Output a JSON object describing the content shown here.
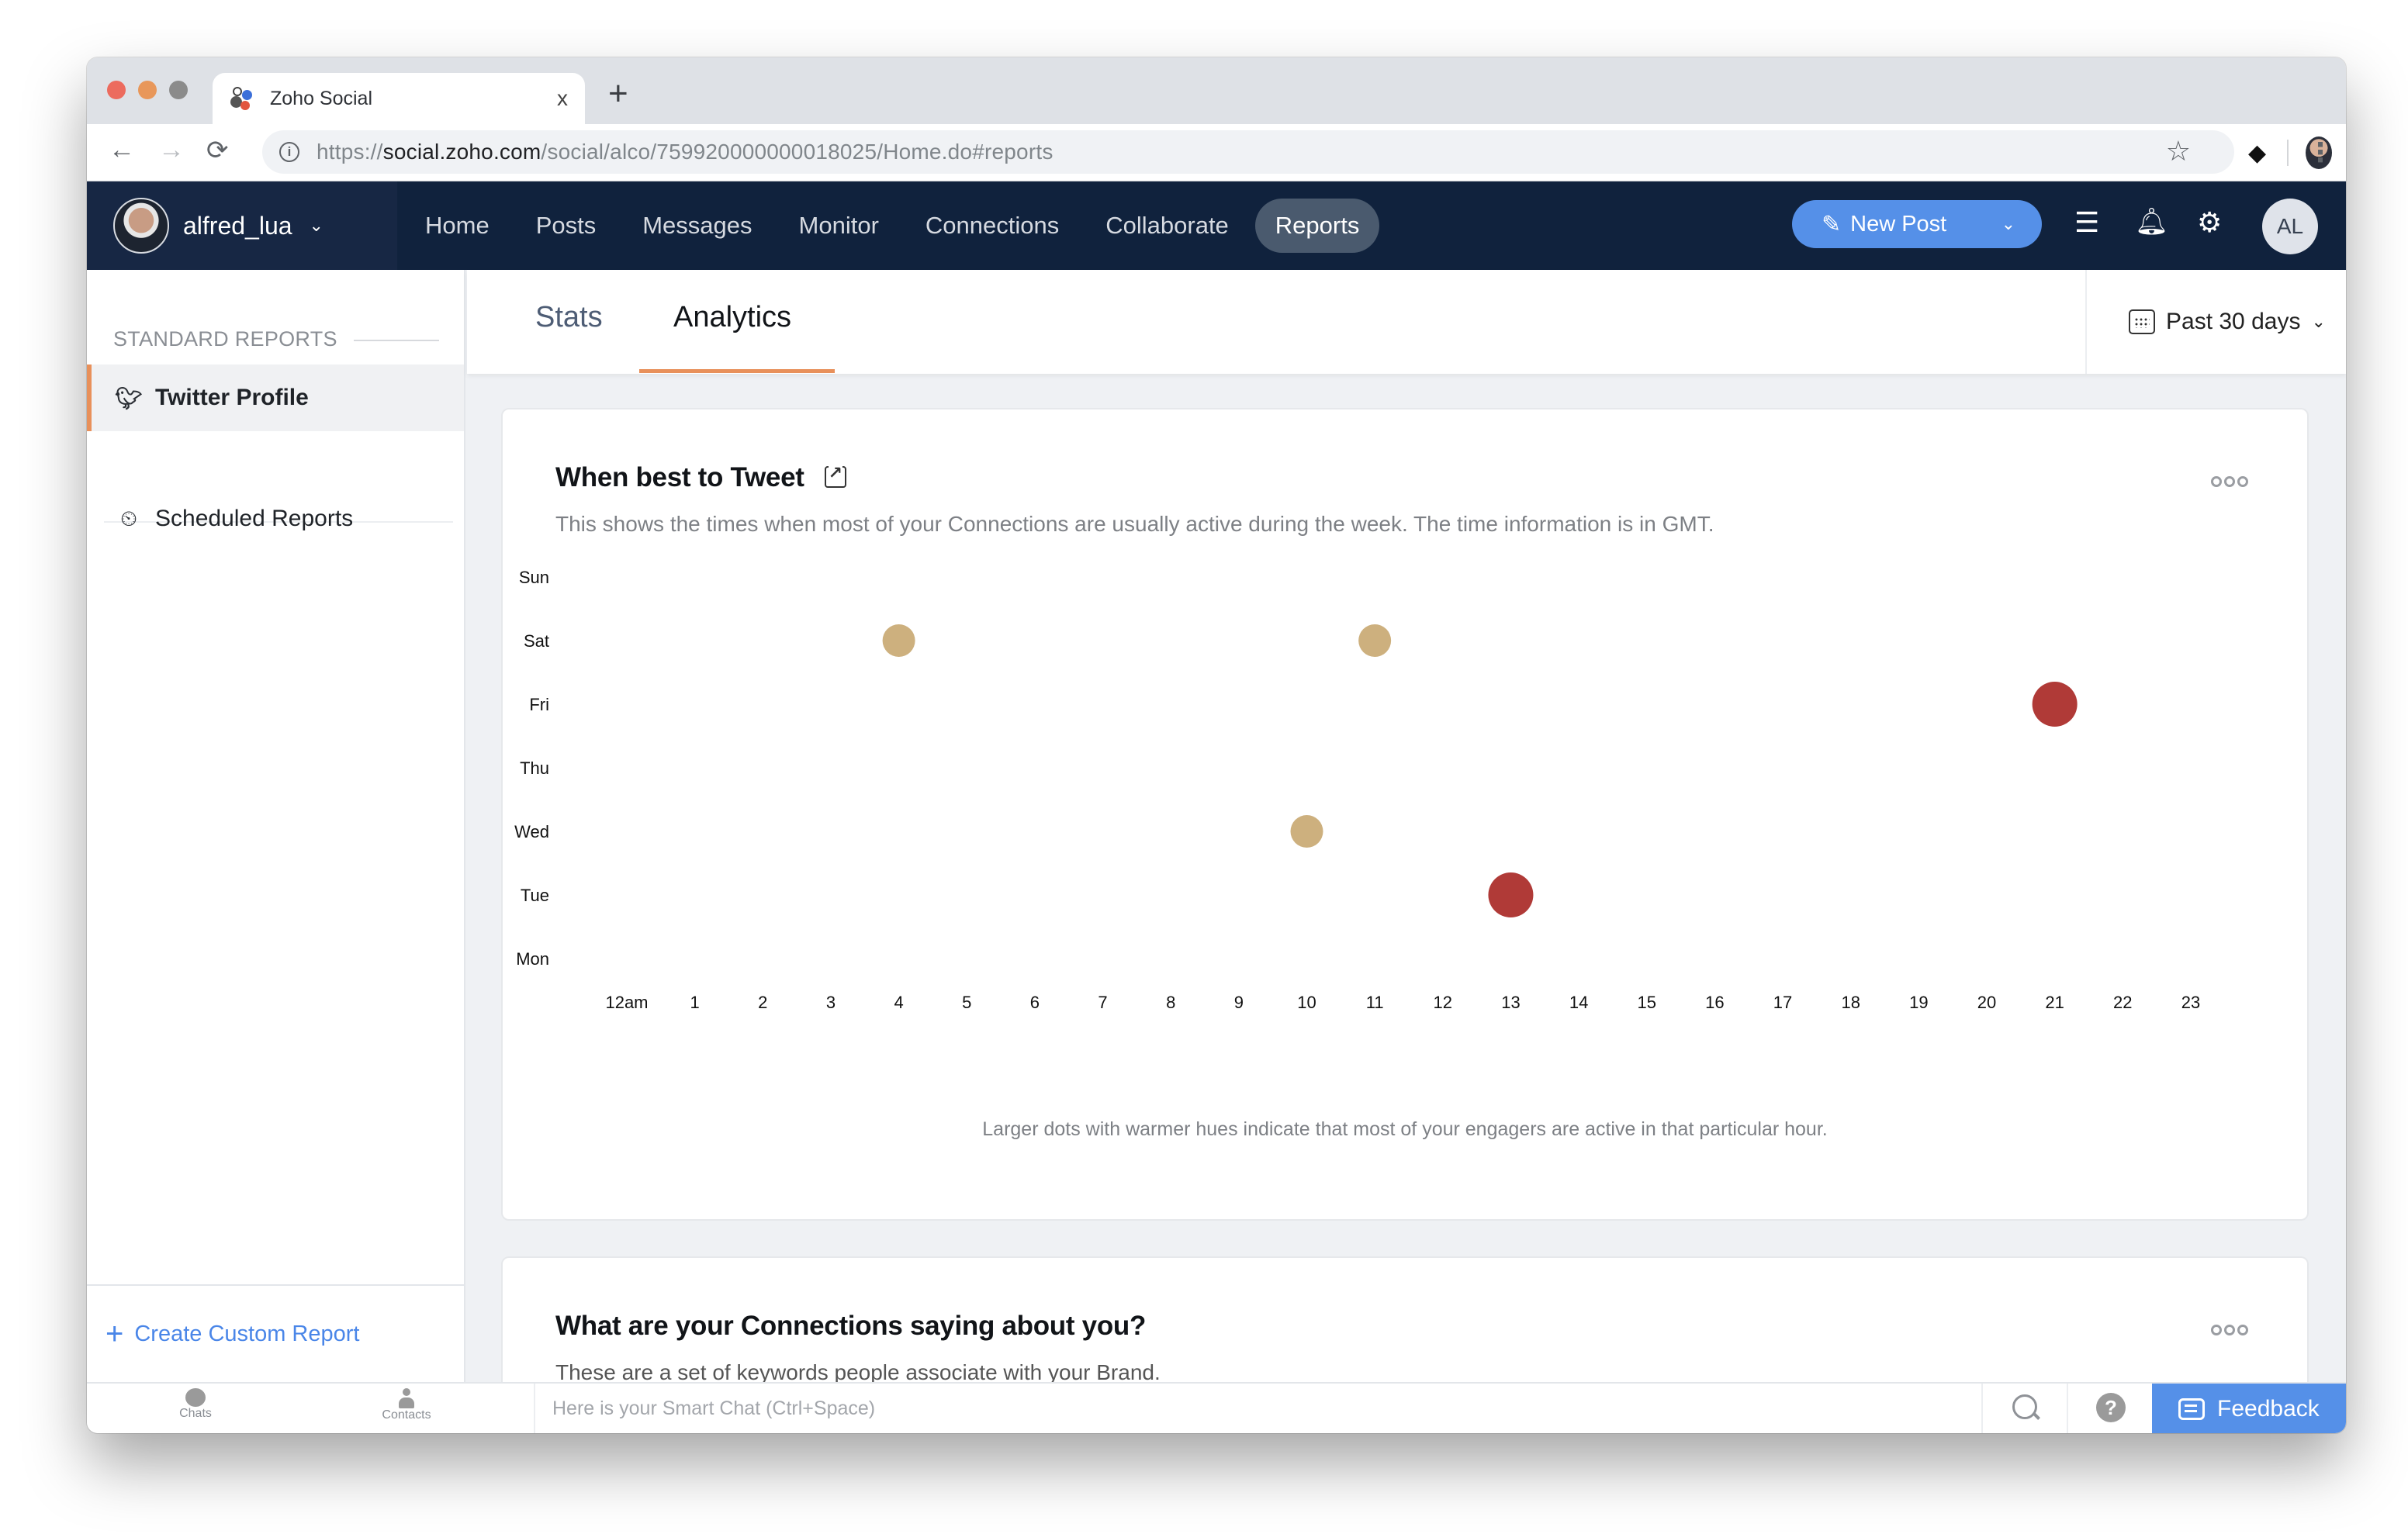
{
  "browser": {
    "tab_title": "Zoho Social",
    "tab_close": "x",
    "new_tab": "+",
    "url_scheme": "https://",
    "url_host": "social.zoho.com",
    "url_path": "/social/alco/759920000000018025/Home.do#reports",
    "back": "←",
    "forward": "→",
    "reload": "⟳"
  },
  "appnav": {
    "username": "alfred_lua",
    "items": [
      {
        "label": "Home"
      },
      {
        "label": "Posts"
      },
      {
        "label": "Messages"
      },
      {
        "label": "Monitor"
      },
      {
        "label": "Connections"
      },
      {
        "label": "Collaborate"
      },
      {
        "label": "Reports",
        "active": true
      }
    ],
    "new_post_label": "New Post",
    "avatar_initials": "AL"
  },
  "sidebar": {
    "heading": "STANDARD REPORTS",
    "items": [
      {
        "label": "Twitter Profile",
        "icon": "twitter-icon",
        "active": true
      },
      {
        "label": "Scheduled Reports",
        "icon": "scheduled-report-icon"
      }
    ],
    "footer_label": "Create Custom Report"
  },
  "subtabs": {
    "tabs": [
      {
        "label": "Stats"
      },
      {
        "label": "Analytics",
        "active": true
      }
    ],
    "date_filter": "Past 30 days"
  },
  "cards": [
    {
      "title": "When best to Tweet",
      "description": "This shows the times when most of your Connections are usually active during the week. The time information is in GMT.",
      "note": "Larger dots with warmer hues indicate that most of your engagers are active in that particular hour."
    },
    {
      "title": "What are your Connections saying about you?",
      "description": "These are a set of keywords people associate with your Brand."
    }
  ],
  "chart_data": {
    "type": "scatter",
    "title": "When best to Tweet",
    "xlabel": "",
    "ylabel": "",
    "x_categories": [
      "12am",
      "1",
      "2",
      "3",
      "4",
      "5",
      "6",
      "7",
      "8",
      "9",
      "10",
      "11",
      "12",
      "13",
      "14",
      "15",
      "16",
      "17",
      "18",
      "19",
      "20",
      "21",
      "22",
      "23"
    ],
    "y_categories": [
      "Mon",
      "Tue",
      "Wed",
      "Thu",
      "Fri",
      "Sat",
      "Sun"
    ],
    "grid": false,
    "legend": "none",
    "colors": {
      "low": "#cdb07e",
      "high": "#b03a37"
    },
    "points": [
      {
        "day": "Sat",
        "hour": 4,
        "intensity": "low"
      },
      {
        "day": "Sat",
        "hour": 11,
        "intensity": "low"
      },
      {
        "day": "Fri",
        "hour": 21,
        "intensity": "high"
      },
      {
        "day": "Wed",
        "hour": 10,
        "intensity": "low"
      },
      {
        "day": "Tue",
        "hour": 13,
        "intensity": "high"
      }
    ]
  },
  "bottombar": {
    "chats_label": "Chats",
    "contacts_label": "Contacts",
    "smartchat_placeholder": "Here is your Smart Chat (Ctrl+Space)",
    "help": "?",
    "feedback_label": "Feedback"
  }
}
